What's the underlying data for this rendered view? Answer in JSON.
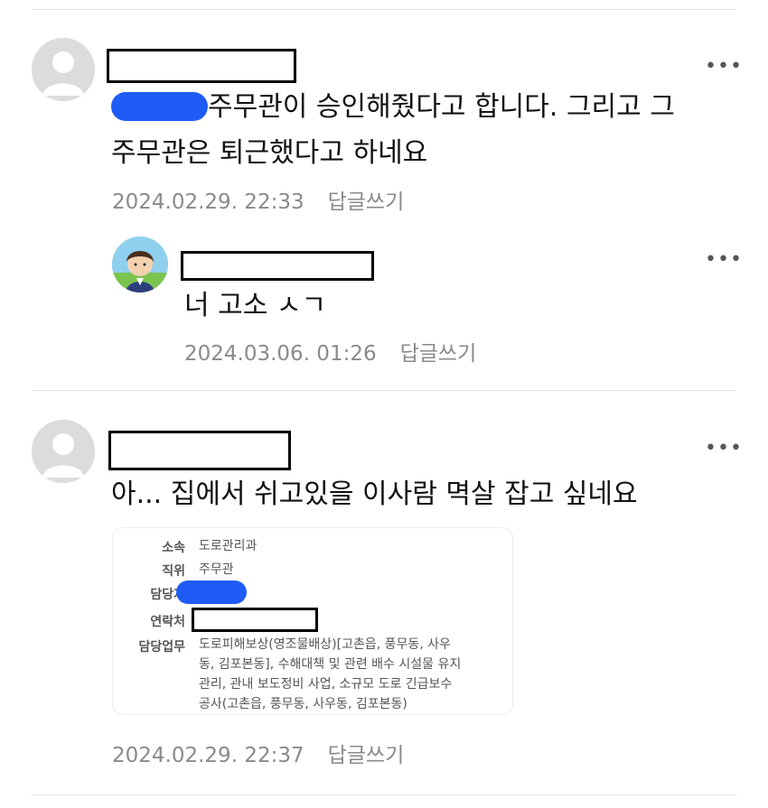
{
  "comments": [
    {
      "text_line1": "주무관이 승인해줬다고 합니다. 그리고 그",
      "text_line2": "주무관은 퇴근했다고 하네요",
      "date": "2024.02.29. 22:33",
      "reply_label": "답글쓰기",
      "more_label": "•••"
    },
    {
      "text": "너 고소 ㅅㄱ",
      "date": "2024.03.06. 01:26",
      "reply_label": "답글쓰기",
      "more_label": "•••"
    },
    {
      "text": "아... 집에서 쉬고있을 이사람 멱살 잡고 싶네요",
      "date": "2024.02.29. 22:37",
      "reply_label": "답글쓰기",
      "more_label": "•••",
      "card": {
        "affiliation_label": "소속",
        "affiliation_value": "도로관리과",
        "position_label": "직위",
        "position_value": "주무관",
        "manager_label": "담당자",
        "contact_label": "연락처",
        "duty_label": "담당업무",
        "duty_line1": "도로피해보상(영조물배상)[고촌읍, 풍무동, 사우",
        "duty_line2": "동, 김포본동], 수해대책 및 관련 배수 시설물 유지",
        "duty_line3": "관리, 관내 보도정비 사업, 소규모 도로 긴급보수",
        "duty_line4": "공사(고촌읍, 풍무동, 사우동, 김포본동)"
      }
    }
  ],
  "colors": {
    "redaction_blob": "#1f5cf5",
    "meta_text": "#8a8a8a"
  },
  "icons": [
    "default-avatar-icon",
    "character-avatar-icon",
    "more-options-icon"
  ]
}
